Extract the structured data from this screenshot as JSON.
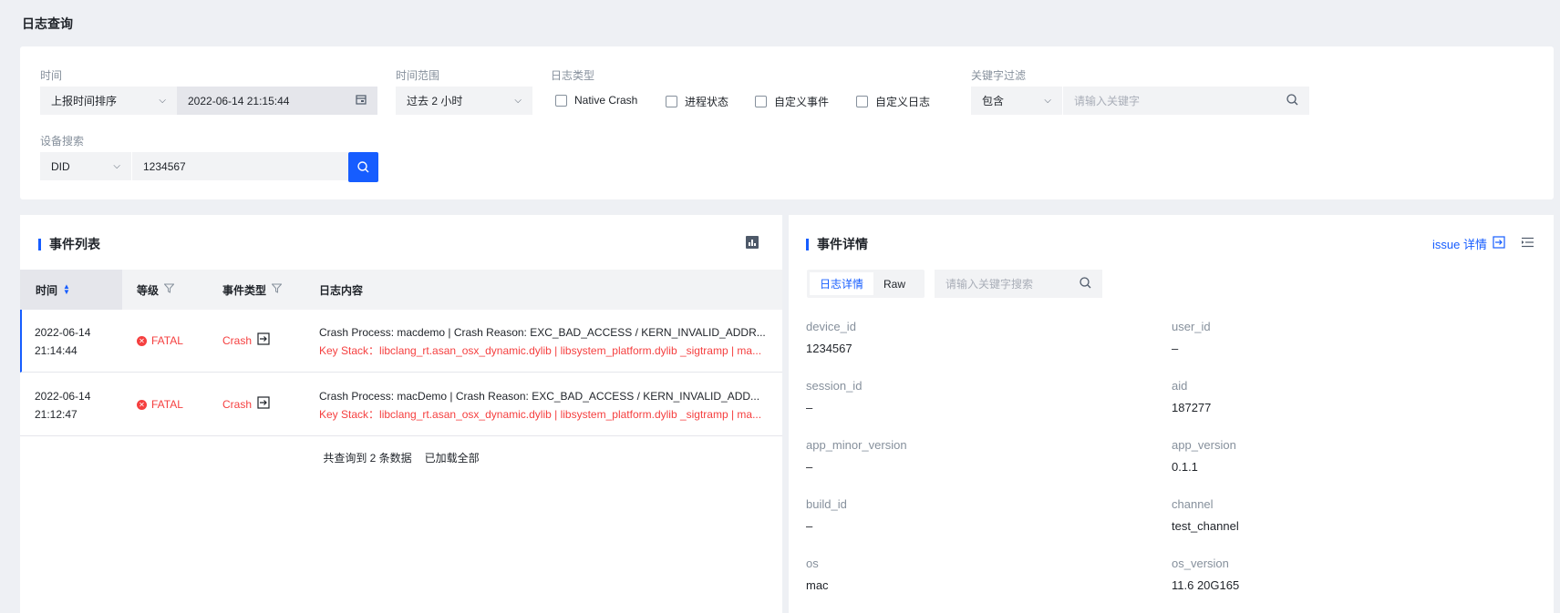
{
  "page_title": "日志查询",
  "filters": {
    "time_label": "时间",
    "time_sort": "上报时间排序",
    "time_value": "2022-06-14 21:15:44",
    "range_label": "时间范围",
    "range_value": "过去 2 小时",
    "log_type_label": "日志类型",
    "log_types": [
      "Native Crash",
      "进程状态",
      "自定义事件",
      "自定义日志"
    ],
    "keyword_label": "关键字过滤",
    "keyword_mode": "包含",
    "keyword_placeholder": "请输入关键字",
    "device_label": "设备搜索",
    "device_type": "DID",
    "device_value": "1234567"
  },
  "event_list": {
    "title": "事件列表",
    "columns": [
      "时间",
      "等级",
      "事件类型",
      "日志内容"
    ],
    "rows": [
      {
        "date": "2022-06-14",
        "time": "21:14:44",
        "level": "FATAL",
        "type": "Crash",
        "log": "Crash Process: macdemo | Crash Reason: EXC_BAD_ACCESS / KERN_INVALID_ADDR...",
        "stack": "Key Stack：libclang_rt.asan_osx_dynamic.dylib | libsystem_platform.dylib _sigtramp | ma..."
      },
      {
        "date": "2022-06-14",
        "time": "21:12:47",
        "level": "FATAL",
        "type": "Crash",
        "log": "Crash Process: macDemo | Crash Reason: EXC_BAD_ACCESS / KERN_INVALID_ADD...",
        "stack": "Key Stack：libclang_rt.asan_osx_dynamic.dylib | libsystem_platform.dylib _sigtramp | ma..."
      }
    ],
    "footer_count": "共查询到 2 条数据",
    "footer_loaded": "已加载全部"
  },
  "event_detail": {
    "title": "事件详情",
    "issue_link": "issue 详情",
    "tabs": [
      "日志详情",
      "Raw"
    ],
    "search_placeholder": "请输入关键字搜索",
    "fields": [
      {
        "key": "device_id",
        "value": "1234567"
      },
      {
        "key": "user_id",
        "value": "–"
      },
      {
        "key": "session_id",
        "value": "–"
      },
      {
        "key": "aid",
        "value": "187277"
      },
      {
        "key": "app_minor_version",
        "value": "–"
      },
      {
        "key": "app_version",
        "value": "0.1.1"
      },
      {
        "key": "build_id",
        "value": "–"
      },
      {
        "key": "channel",
        "value": "test_channel"
      },
      {
        "key": "os",
        "value": "mac"
      },
      {
        "key": "os_version",
        "value": "11.6 20G165"
      }
    ]
  },
  "colors": {
    "accent": "#165dff",
    "fatal": "#f53f3f"
  }
}
